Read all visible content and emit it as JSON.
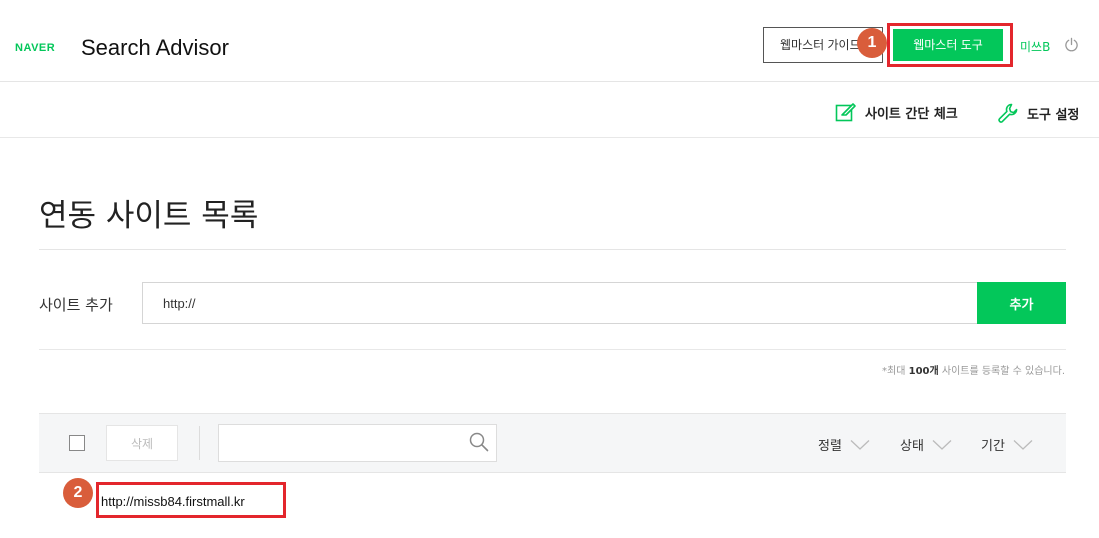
{
  "header": {
    "logo_text": "NAVER",
    "app_title": "Search Advisor",
    "guide_button": "웹마스터 가이드",
    "tools_button": "웹마스터 도구",
    "user_name": "미쓰B",
    "power_icon": "power-icon"
  },
  "toolbar": {
    "site_check": "사이트 간단 체크",
    "settings": "도구 설정"
  },
  "page": {
    "title": "연동 사이트 목록"
  },
  "add_site": {
    "label": "사이트 추가",
    "input_value": "http://",
    "button": "추가",
    "note_prefix": "*최대 ",
    "note_count": "100개",
    "note_suffix": " 사이트를 등록할 수 있습니다."
  },
  "list_bar": {
    "delete_button": "삭제",
    "search_placeholder": "",
    "sort": "정렬",
    "status": "상태",
    "period": "기간"
  },
  "sites": [
    {
      "url": "http://missb84.firstmall.kr"
    }
  ],
  "annotations": {
    "badge1": "1",
    "badge2": "2",
    "highlight_color": "#e3262c",
    "badge_color": "#d95d3b"
  },
  "colors": {
    "brand_green": "#03c75a"
  }
}
